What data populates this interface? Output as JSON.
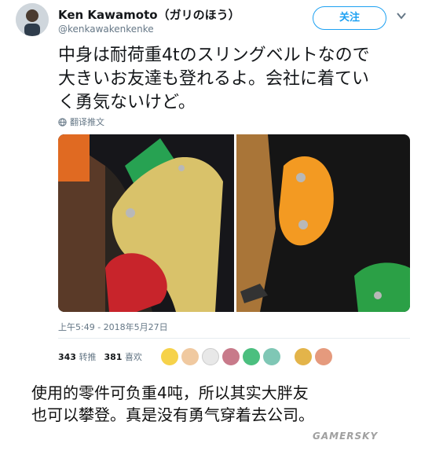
{
  "tweet": {
    "author_name": "Ken Kawamoto（ガリのほう）",
    "author_handle": "@kenkawakenkenke",
    "follow_label": "关注",
    "text_lines": [
      "中身は耐荷重4tのスリングベルトなので",
      "大きいお友達も登れるよ。会社に着てい",
      "く勇気ないけど。"
    ],
    "translate_label": "翻译推文",
    "timestamp": "上午5:49 - 2018年5月27日",
    "retweets_count": "343",
    "retweets_label": "转推",
    "likes_count": "381",
    "likes_label": "喜欢"
  },
  "caption": {
    "lines": [
      "使用的零件可负重4吨，所以其实大胖友",
      "也可以攀登。真是没有勇气穿着去公司。"
    ]
  },
  "watermark": "GAMERSKY",
  "icons": {
    "chevron": "chevron-down-icon",
    "globe": "globe-icon"
  },
  "colors": {
    "accent": "#1da1f2",
    "text": "#14171a",
    "muted": "#657786"
  }
}
